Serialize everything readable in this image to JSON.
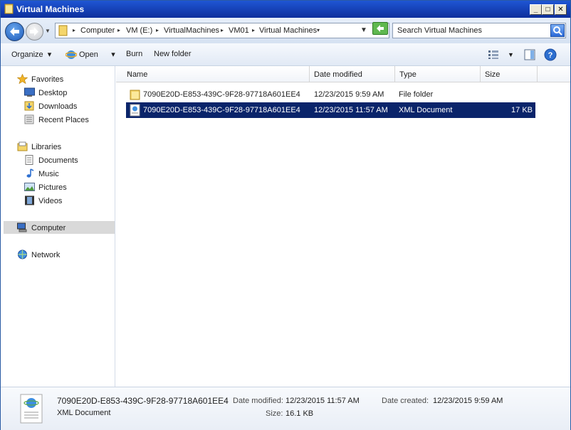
{
  "window": {
    "title": "Virtual Machines"
  },
  "address": {
    "crumbs": [
      "Computer",
      "VM (E:)",
      "VirtualMachines",
      "VM01",
      "Virtual Machines"
    ],
    "search_placeholder": "Search Virtual Machines"
  },
  "toolbar": {
    "organize": "Organize",
    "open": "Open",
    "burn": "Burn",
    "new_folder": "New folder"
  },
  "nav": {
    "favorites": "Favorites",
    "desktop": "Desktop",
    "downloads": "Downloads",
    "recent": "Recent Places",
    "libraries": "Libraries",
    "documents": "Documents",
    "music": "Music",
    "pictures": "Pictures",
    "videos": "Videos",
    "computer": "Computer",
    "network": "Network"
  },
  "columns": {
    "name": "Name",
    "date": "Date modified",
    "type": "Type",
    "size": "Size"
  },
  "files": [
    {
      "name": "7090E20D-E853-439C-9F28-97718A601EE4",
      "date": "12/23/2015 9:59 AM",
      "type": "File folder",
      "size": ""
    },
    {
      "name": "7090E20D-E853-439C-9F28-97718A601EE4",
      "date": "12/23/2015 11:57 AM",
      "type": "XML Document",
      "size": "17 KB"
    }
  ],
  "details": {
    "name": "7090E20D-E853-439C-9F28-97718A601EE4",
    "type": "XML Document",
    "date_modified_label": "Date modified:",
    "date_modified": "12/23/2015 11:57 AM",
    "date_created_label": "Date created:",
    "date_created": "12/23/2015 9:59 AM",
    "size_label": "Size:",
    "size": "16.1 KB"
  },
  "colors": {
    "selection": "#0a246a",
    "title_bar": "#1f56d4"
  }
}
